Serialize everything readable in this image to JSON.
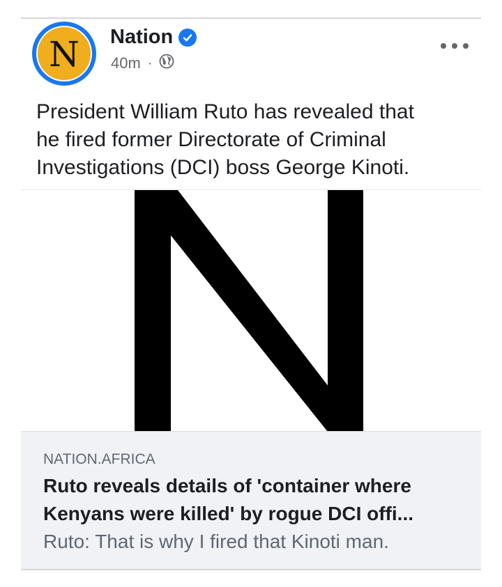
{
  "post": {
    "page_name": "Nation",
    "avatar_letter": "N",
    "timestamp": "40m",
    "separator": "·",
    "verified_icon": "verified-check-icon",
    "audience_icon": "globe-icon",
    "more_icon": "more-options-icon",
    "caption_lines": [
      "President William Ruto has revealed that",
      "he fired former Directorate of Criminal",
      "Investigations (DCI) boss George Kinoti."
    ]
  },
  "link_preview": {
    "image_letter": "N",
    "domain": "NATION.AFRICA",
    "headline_lines": [
      "Ruto reveals details of 'container where",
      "Kenyans were killed' by rogue DCI offi..."
    ],
    "description": "Ruto: That is why I fired that Kinoti man."
  },
  "colors": {
    "brand_blue": "#1877f2",
    "avatar_yellow": "#f0ad1d",
    "card_background": "#f0f2f5"
  }
}
